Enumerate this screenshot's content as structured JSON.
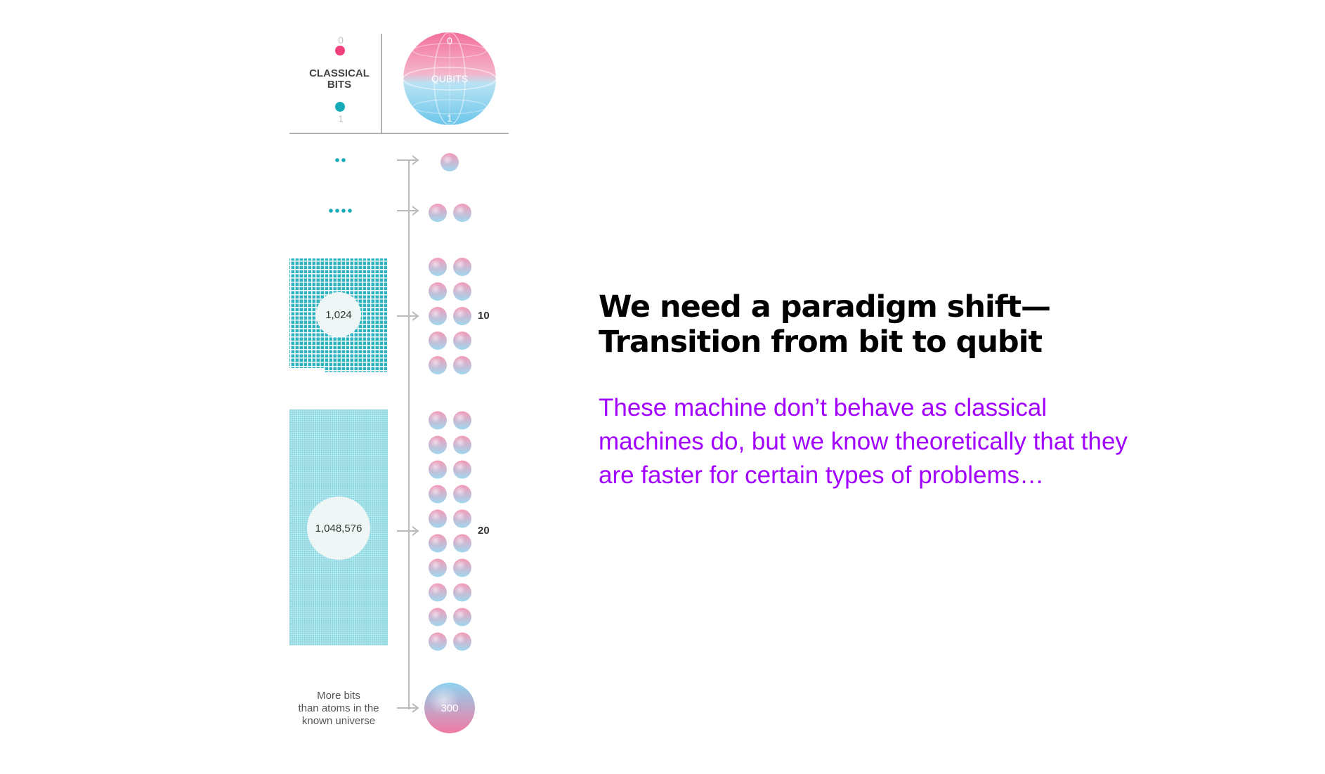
{
  "colors": {
    "pink": "#f0407a",
    "teal": "#17aab8",
    "grid_teal": "#7fd6df",
    "accent_purple": "#a100ff"
  },
  "header": {
    "classical_bits_line1": "CLASSICAL",
    "classical_bits_line2": "BITS",
    "bit_zero": "0",
    "bit_one": "1",
    "qubits_label": "QUBITS",
    "sphere_zero": "0",
    "sphere_one": "1"
  },
  "rows": [
    {
      "classical_count": "",
      "qubits": 1,
      "qubit_label": ""
    },
    {
      "classical_count": "",
      "qubits": 2,
      "qubit_label": ""
    },
    {
      "classical_count": "1,024",
      "qubits": 10,
      "qubit_label": "10"
    },
    {
      "classical_count": "1,048,576",
      "qubits": 20,
      "qubit_label": "20"
    }
  ],
  "universe": {
    "line1": "More bits",
    "line2": "than atoms in the",
    "line3": "known universe",
    "qubit_count": "300"
  },
  "slide": {
    "title_line1": "We need a paradigm shift—",
    "title_line2": "Transition from bit to qubit",
    "body": "These machine don’t behave as classical machines do, but we know theoretically that they are faster for certain types of problems…"
  }
}
